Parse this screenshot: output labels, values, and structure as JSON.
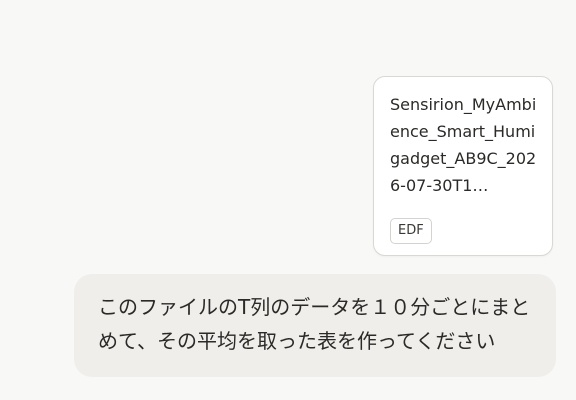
{
  "attachment": {
    "file_name": "Sensirion_MyAmbience_Smart_Humigadget_AB9C_2026-07-30T1…",
    "file_type": "EDF"
  },
  "user_message": {
    "text": "このファイルのT列のデータを１０分ごとにまとめて、その平均を取った表を作ってください"
  }
}
